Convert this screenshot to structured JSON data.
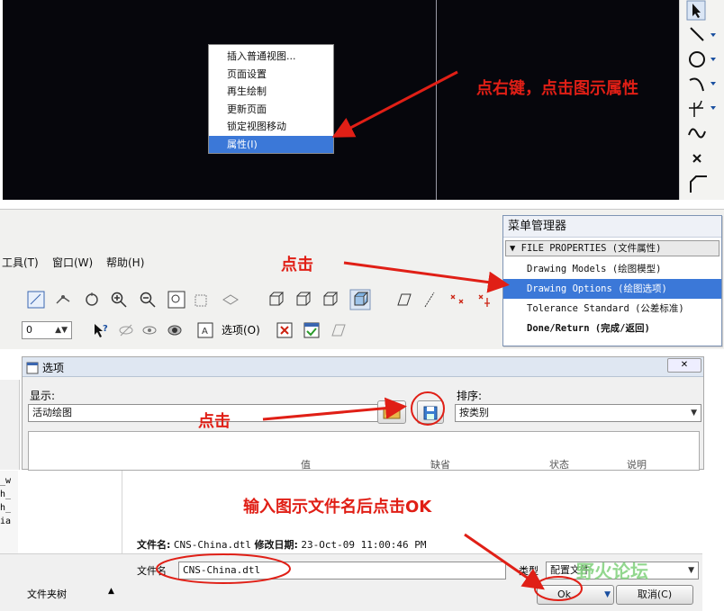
{
  "panel1": {
    "context_menu": {
      "items": [
        {
          "label": "插入普通视图..."
        },
        {
          "label": "页面设置"
        },
        {
          "label": "再生绘制"
        },
        {
          "label": "更新页面"
        },
        {
          "label": "锁定视图移动"
        },
        {
          "label": "属性(I)",
          "selected": true
        }
      ]
    },
    "annotation": "点右键，点击图示属性",
    "right_toolbar_icons": [
      "select-arrow-icon",
      "line-icon",
      "circle-icon",
      "arc-icon",
      "fillet-icon",
      "spline-icon",
      "point-icon",
      "chamfer-icon"
    ]
  },
  "panel2": {
    "menubar": [
      "工具(T)",
      "窗口(W)",
      "帮助(H)"
    ],
    "options_label": "选项(O)",
    "spinner_value": "0",
    "annotation": "点击",
    "menu_manager": {
      "title": "菜单管理器",
      "header": "FILE PROPERTIES (文件属性)",
      "items": [
        {
          "label": "Drawing Models (绘图模型)"
        },
        {
          "label": "Drawing Options (绘图选项)",
          "selected": true
        },
        {
          "label": "Tolerance Standard (公差标准)"
        },
        {
          "label": "Done/Return (完成/返回)",
          "bold": true
        }
      ]
    }
  },
  "panel3": {
    "dialog_title": "选项",
    "display_label": "显示:",
    "display_value": "活动绘图",
    "sort_label": "排序:",
    "sort_value": "按类别",
    "annotation": "点击",
    "column_headers": [
      "值",
      "缺省",
      "状态",
      "说明"
    ]
  },
  "panel4": {
    "annotation": "输入图示文件名后点击OK",
    "info_filename_label": "文件名:",
    "info_filename_value": "CNS-China.dtl",
    "info_modified_label": "修改日期:",
    "info_modified_value": "23-Oct-09 11:00:46 PM",
    "filename_label": "文件名",
    "filename_value": "CNS-China.dtl",
    "type_label": "类型",
    "type_value": "配置文件",
    "ok_label": "Ok",
    "cancel_label": "取消(C)",
    "folder_tree_label": "文件夹树",
    "left_list": [
      "_w",
      "h_",
      "h_",
      "ia"
    ]
  },
  "watermark": "野火论坛",
  "colors": {
    "annotation_red": "#e01f16",
    "selection_blue": "#3b78d8",
    "canvas_black": "#06060c"
  }
}
